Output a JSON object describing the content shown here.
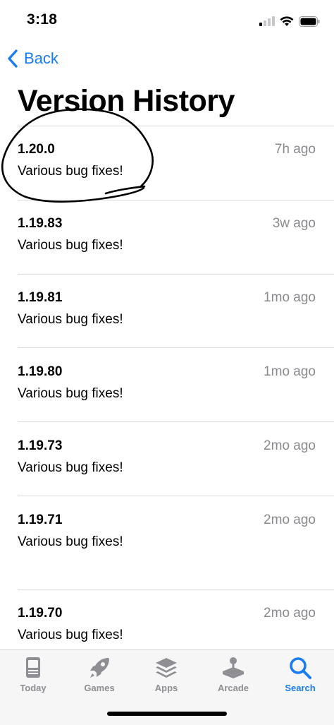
{
  "status_bar": {
    "time": "3:18"
  },
  "nav": {
    "back_label": "Back"
  },
  "page": {
    "title": "Version History"
  },
  "versions": [
    {
      "version": "1.20.0",
      "time": "7h ago",
      "notes": "Various bug fixes!"
    },
    {
      "version": "1.19.83",
      "time": "3w ago",
      "notes": "Various bug fixes!"
    },
    {
      "version": "1.19.81",
      "time": "1mo ago",
      "notes": "Various bug fixes!"
    },
    {
      "version": "1.19.80",
      "time": "1mo ago",
      "notes": "Various bug fixes!"
    },
    {
      "version": "1.19.73",
      "time": "2mo ago",
      "notes": "Various bug fixes!"
    },
    {
      "version": "1.19.71",
      "time": "2mo ago",
      "notes": "Various bug fixes!"
    },
    {
      "version": "1.19.70",
      "time": "2mo ago",
      "notes": "Various bug fixes!"
    }
  ],
  "tabs": [
    {
      "label": "Today",
      "icon": "today-icon",
      "active": false
    },
    {
      "label": "Games",
      "icon": "rocket-icon",
      "active": false
    },
    {
      "label": "Apps",
      "icon": "stack-icon",
      "active": false
    },
    {
      "label": "Arcade",
      "icon": "joystick-icon",
      "active": false
    },
    {
      "label": "Search",
      "icon": "search-icon",
      "active": true
    }
  ],
  "colors": {
    "accent": "#1a7cf4",
    "secondary_text": "#8a8a8e",
    "inactive_tab": "#8e8e93"
  }
}
